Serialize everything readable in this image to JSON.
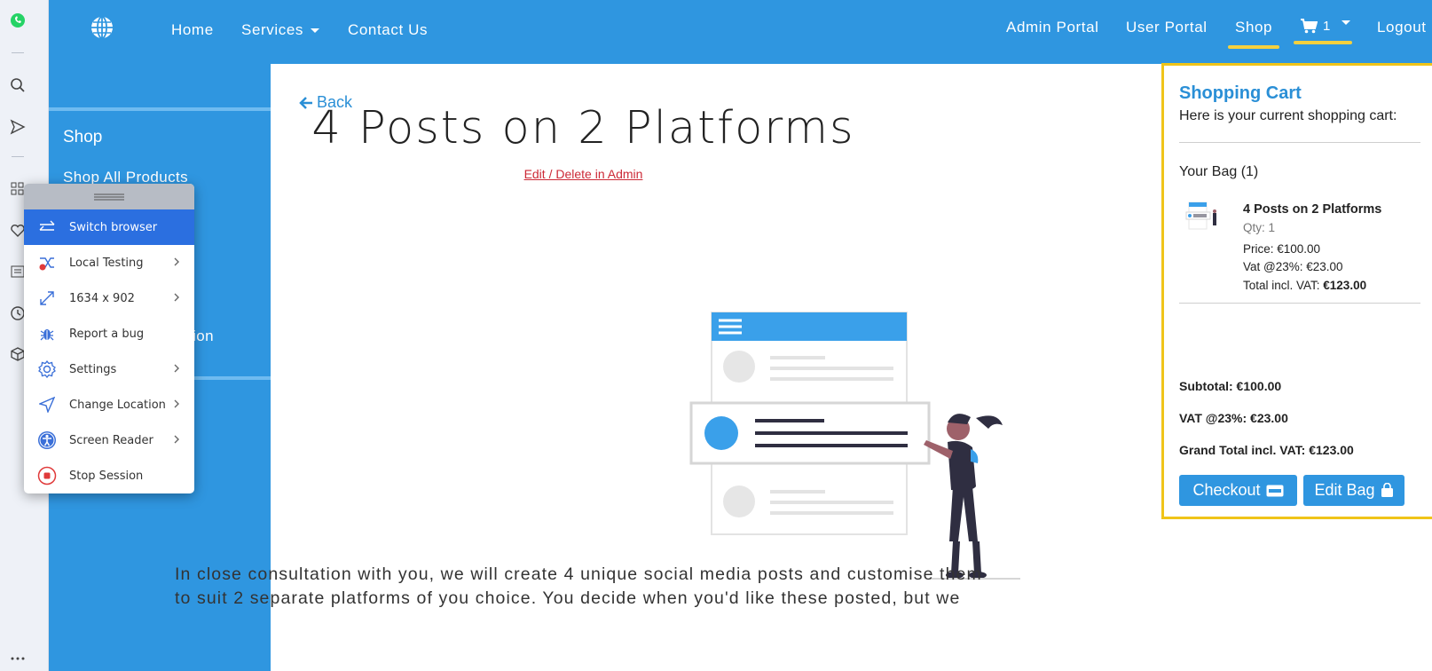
{
  "navbar": {
    "home": "Home",
    "services": "Services",
    "contact": "Contact Us",
    "admin_portal": "Admin Portal",
    "user_portal": "User Portal",
    "shop": "Shop",
    "cart_count": "1",
    "logout": "Logout"
  },
  "sidebar": {
    "title": "Shop",
    "all_products": "Shop All Products",
    "partial_link": "tion"
  },
  "main": {
    "back": "Back",
    "title": "4 Posts on 2 Platforms",
    "edit_link": "Edit / Delete in Admin",
    "description_line1": "In close consultation with you, we will create 4 unique social media posts and customise them",
    "description_line2": "to suit 2 separate platforms of you choice. You decide when you'd like these posted, but we"
  },
  "browser_menu": {
    "items": [
      {
        "label": "Switch browser",
        "icon": "switch-browser-icon",
        "submenu": false
      },
      {
        "label": "Local Testing",
        "icon": "local-testing-icon",
        "submenu": true
      },
      {
        "label": "1634 x 902",
        "icon": "resolution-icon",
        "submenu": true
      },
      {
        "label": "Report a bug",
        "icon": "bug-icon",
        "submenu": false
      },
      {
        "label": "Settings",
        "icon": "settings-icon",
        "submenu": true
      },
      {
        "label": "Change Location",
        "icon": "location-icon",
        "submenu": true
      },
      {
        "label": "Screen Reader",
        "icon": "screen-reader-icon",
        "submenu": true
      },
      {
        "label": "Stop Session",
        "icon": "stop-session-icon",
        "submenu": false
      }
    ]
  },
  "cart": {
    "title": "Shopping Cart",
    "subtitle": "Here is your current shopping cart:",
    "bag_label": "Your Bag (1)",
    "item": {
      "name": "4 Posts on 2 Platforms",
      "qty": "Qty: 1",
      "price": "Price: €100.00",
      "vat": "Vat @23%: €23.00",
      "total_label": "Total incl. VAT: ",
      "total_value": "€123.00"
    },
    "subtotal": "Subtotal: €100.00",
    "vat_total": "VAT @23%: €23.00",
    "grand_total": "Grand Total incl. VAT: €123.00",
    "checkout_label": "Checkout",
    "edit_bag_label": "Edit Bag"
  },
  "colors": {
    "brand_blue": "#2f96e0",
    "accent_yellow": "#f0c419",
    "menu_active": "#2b6fe0",
    "edit_red": "#cc2936"
  }
}
